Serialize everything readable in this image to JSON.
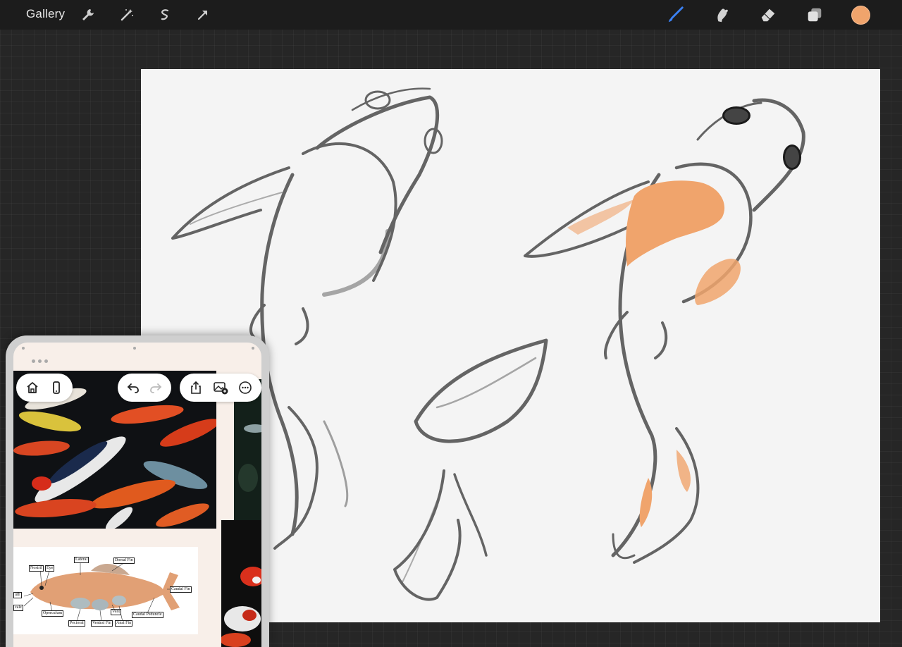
{
  "toolbar": {
    "gallery_label": "Gallery",
    "left_tools": [
      "wrench-icon",
      "magic-wand-icon",
      "selection-icon",
      "transform-arrow-icon"
    ],
    "right_tools": [
      "brush-icon",
      "smudge-icon",
      "eraser-icon",
      "layers-icon"
    ],
    "active_tool": "brush",
    "current_color": "#f0a46c",
    "brush_accent": "#3b82f6"
  },
  "reference_overlay": {
    "nav_buttons": [
      "home-icon",
      "phone-icon"
    ],
    "history_buttons": [
      "undo-icon",
      "redo-icon"
    ],
    "action_buttons": [
      "share-icon",
      "add-image-icon",
      "more-icon"
    ],
    "diagram_labels": {
      "lateral": "Lateral",
      "dorsal_fin": "Dorsal Fin",
      "nostril": "Nostril",
      "eye": "Eye",
      "caudal_fin": "Caudal Fin",
      "mouth": "uth",
      "barbels": "cale",
      "operculum": "Operculum",
      "vent": "Vent",
      "pectoral": "Pectoral",
      "ventral_fin": "Ventral Fin",
      "anal_fin": "Anal Fin",
      "caudal_peduncle": "Caudal Peduncle"
    }
  }
}
